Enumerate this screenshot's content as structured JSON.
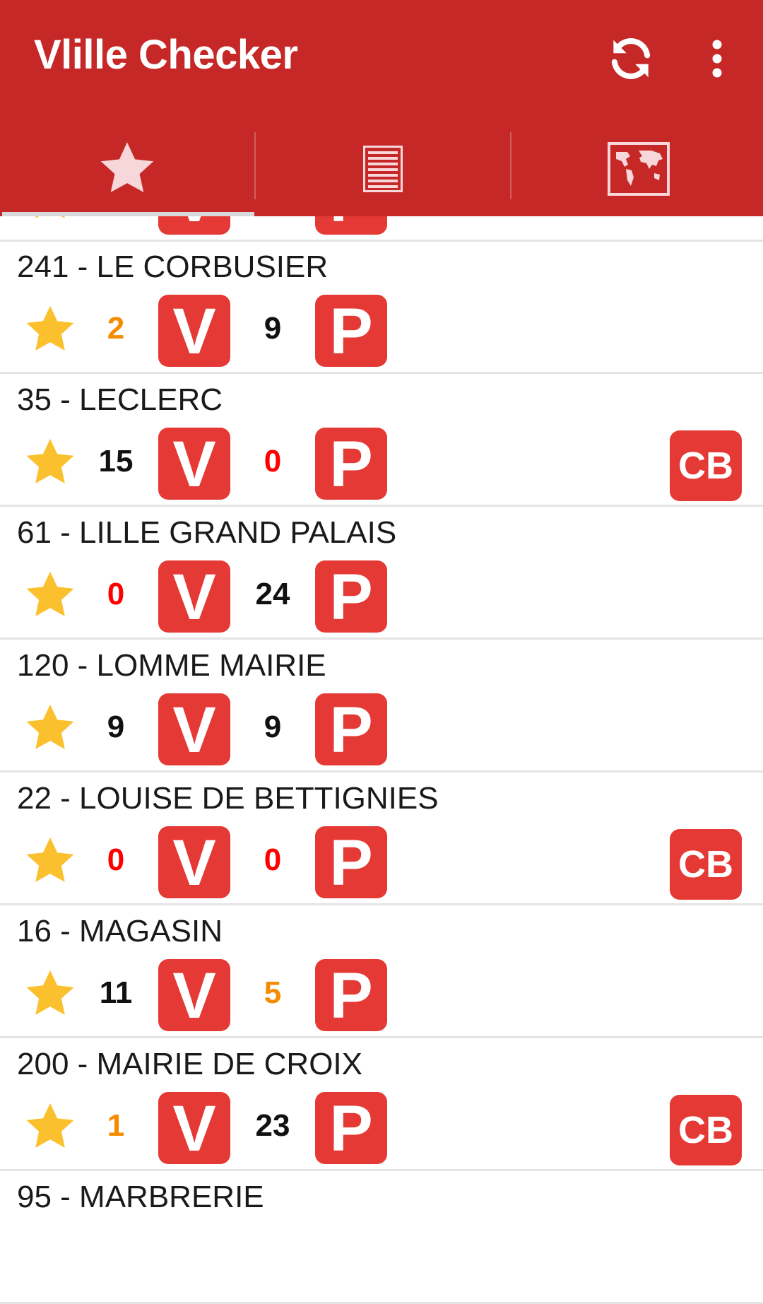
{
  "app": {
    "title": "Vlille Checker"
  },
  "actions": {
    "refresh_icon": "refresh-icon",
    "menu_icon": "more-vert-icon"
  },
  "tabs": [
    {
      "icon": "star-icon"
    },
    {
      "icon": "list-icon"
    },
    {
      "icon": "map-icon"
    }
  ],
  "colors": {
    "primary": "#c62828",
    "badge": "#e53935",
    "star": "#fbc02d",
    "ok": "#111111",
    "low": "#f58c00",
    "empty": "#ff0000"
  },
  "badges": {
    "bikes": "V",
    "places": "P",
    "card": "CB"
  },
  "stations": [
    {
      "name": "241 - LE CORBUSIER",
      "bikes": "2",
      "bikes_status": "low",
      "places": "9",
      "places_status": "ok",
      "cb": false
    },
    {
      "name": "35 - LECLERC",
      "bikes": "15",
      "bikes_status": "ok",
      "places": "0",
      "places_status": "empty",
      "cb": true
    },
    {
      "name": "61 - LILLE GRAND PALAIS",
      "bikes": "0",
      "bikes_status": "empty",
      "places": "24",
      "places_status": "ok",
      "cb": false
    },
    {
      "name": "120 - LOMME MAIRIE",
      "bikes": "9",
      "bikes_status": "ok",
      "places": "9",
      "places_status": "ok",
      "cb": false
    },
    {
      "name": "22 - LOUISE DE BETTIGNIES",
      "bikes": "0",
      "bikes_status": "empty",
      "places": "0",
      "places_status": "empty",
      "cb": true
    },
    {
      "name": "16 - MAGASIN",
      "bikes": "11",
      "bikes_status": "ok",
      "places": "5",
      "places_status": "low",
      "cb": false
    },
    {
      "name": "200 - MAIRIE DE CROIX",
      "bikes": "1",
      "bikes_status": "low",
      "places": "23",
      "places_status": "ok",
      "cb": true
    },
    {
      "name": "95 - MARBRERIE"
    }
  ]
}
